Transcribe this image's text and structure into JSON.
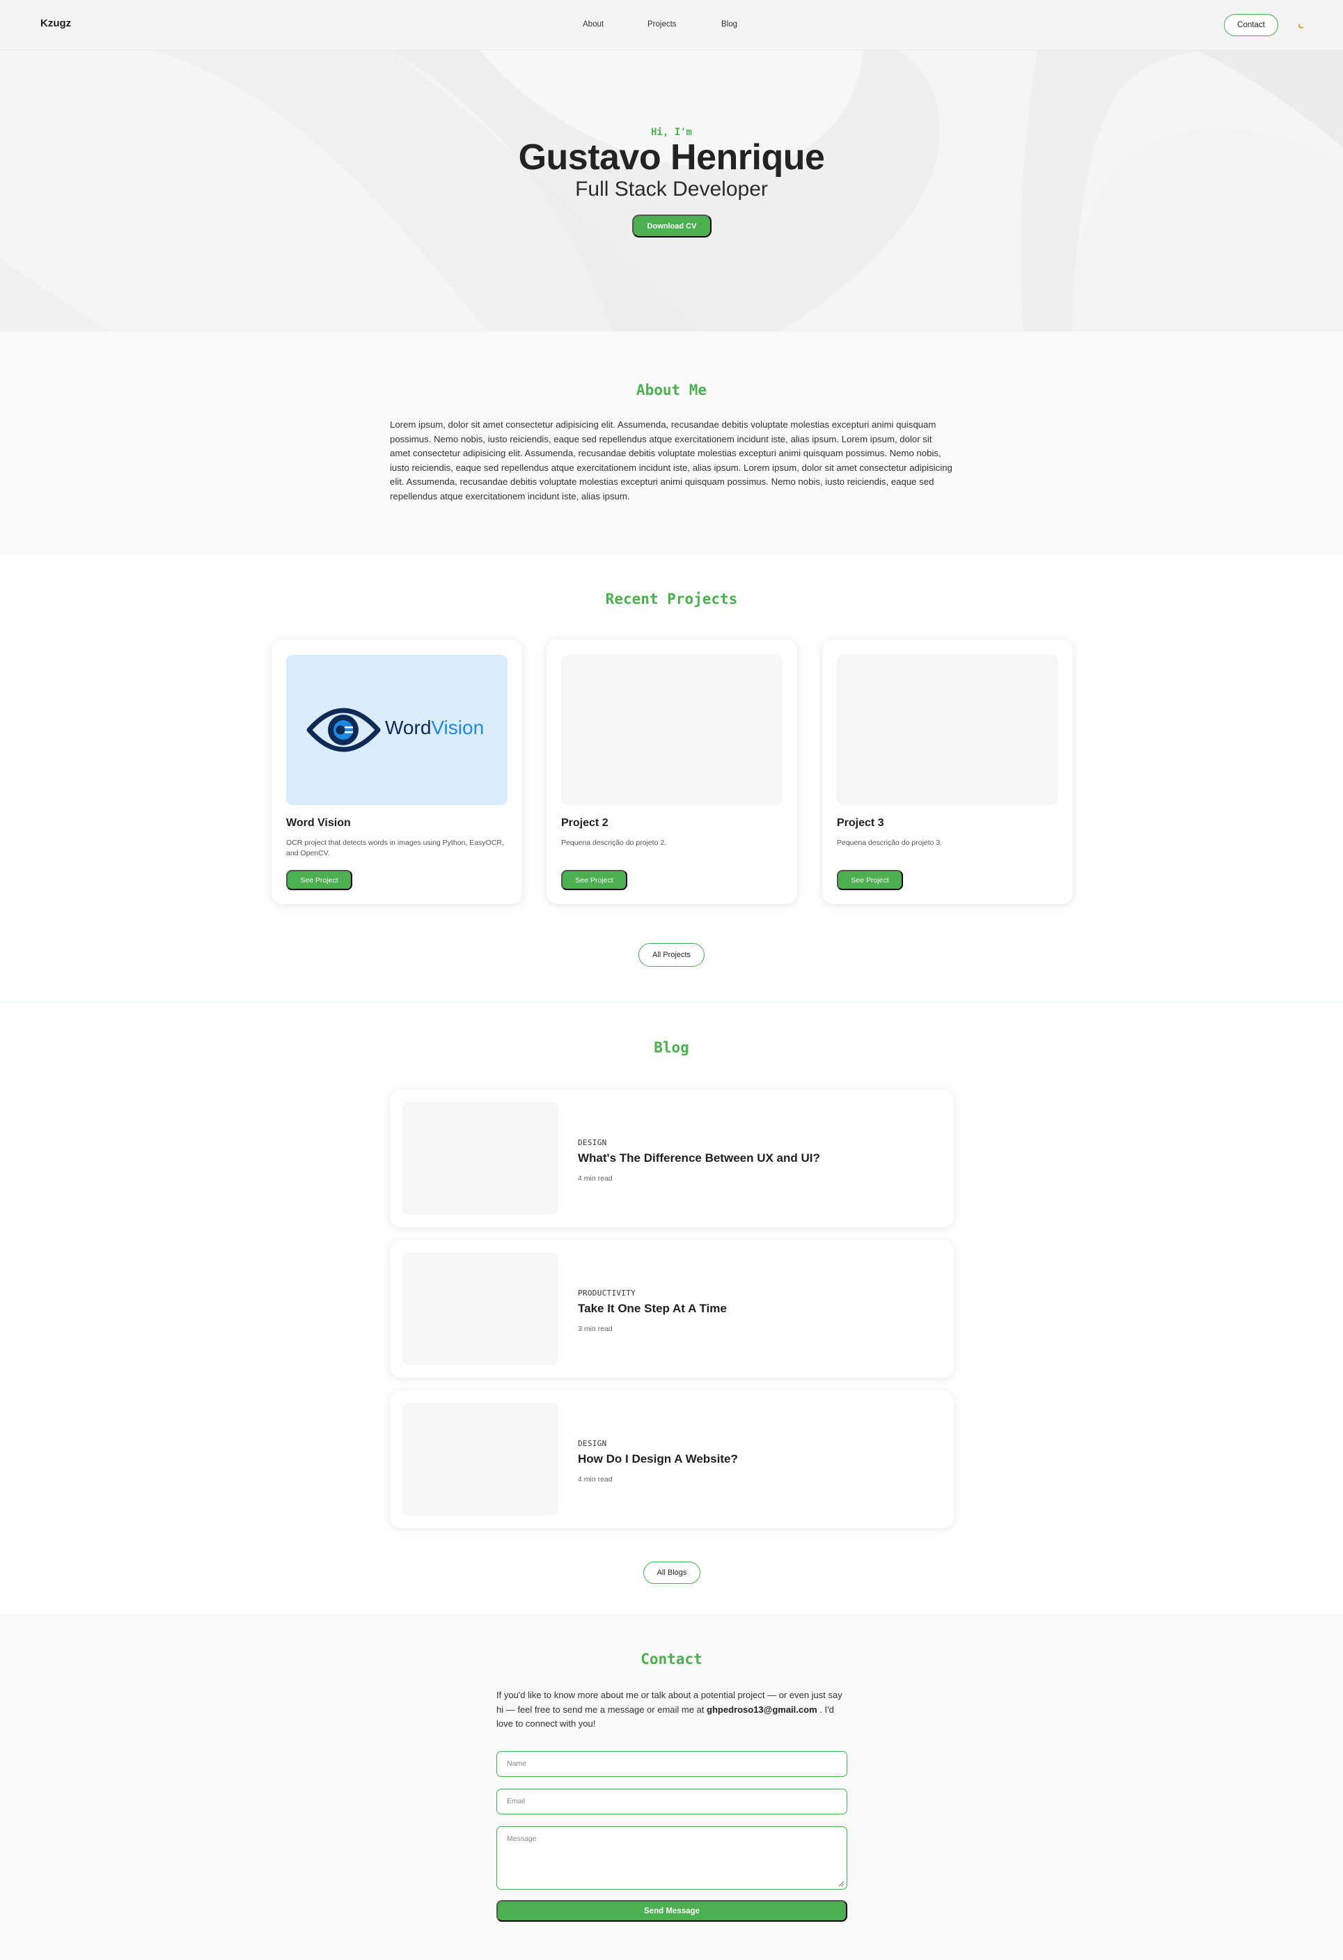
{
  "nav": {
    "brand": "Kzugz",
    "links": [
      "About",
      "Projects",
      "Blog"
    ],
    "contact_label": "Contact"
  },
  "hero": {
    "greeting": "Hi, I'm",
    "name": "Gustavo Henrique",
    "role": "Full Stack Developer",
    "cv_label": "Download CV"
  },
  "about": {
    "title": "About Me",
    "text": "Lorem ipsum, dolor sit amet consectetur adipisicing elit. Assumenda, recusandae debitis voluptate molestias excepturi animi quisquam possimus. Nemo nobis, iusto reiciendis, eaque sed repellendus atque exercitationem incidunt iste, alias ipsum. Lorem ipsum, dolor sit amet consectetur adipisicing elit. Assumenda, recusandae debitis voluptate molestias excepturi animi quisquam possimus. Nemo nobis, iusto reiciendis, eaque sed repellendus atque exercitationem incidunt iste, alias ipsum. Lorem ipsum, dolor sit amet consectetur adipisicing elit. Assumenda, recusandae debitis voluptate molestias excepturi animi quisquam possimus. Nemo nobis, iusto reiciendis, eaque sed repellendus atque exercitationem incidunt iste, alias ipsum."
  },
  "projects": {
    "title": "Recent Projects",
    "items": [
      {
        "title": "Word Vision",
        "desc": "OCR project that detects words in images using Python, EasyOCR, and OpenCV.",
        "button": "See Project",
        "logo_word": "Word",
        "logo_accent": "Vision"
      },
      {
        "title": "Project 2",
        "desc": "Pequena descrição do projeto 2.",
        "button": "See Project"
      },
      {
        "title": "Project 3",
        "desc": "Pequena descrição do projeto 3.",
        "button": "See Project"
      }
    ],
    "all_label": "All Projects"
  },
  "blog": {
    "title": "Blog",
    "posts": [
      {
        "category": "DESIGN",
        "title": "What's The Difference Between UX and UI?",
        "read": "4 min read"
      },
      {
        "category": "PRODUCTIVITY",
        "title": "Take It One Step At A Time",
        "read": "3 min read"
      },
      {
        "category": "DESIGN",
        "title": "How Do I Design A Website?",
        "read": "4 min read"
      }
    ],
    "all_label": "All Blogs"
  },
  "contact": {
    "title": "Contact",
    "text_before": "If you'd like to know more about me or talk about a potential project — or even just say hi — feel free to send me a message or email me at ",
    "email": "ghpedroso13@gmail.com",
    "text_after": " . I'd love to connect with you!",
    "name_placeholder": "Name",
    "email_placeholder": "Email",
    "message_placeholder": "Message",
    "send_label": "Send Message"
  },
  "colors": {
    "accent": "#4caf50",
    "logo_dark": "#0e2a55",
    "logo_blue": "#1e88e5"
  },
  "icons": {
    "theme_toggle": "moon-icon"
  }
}
